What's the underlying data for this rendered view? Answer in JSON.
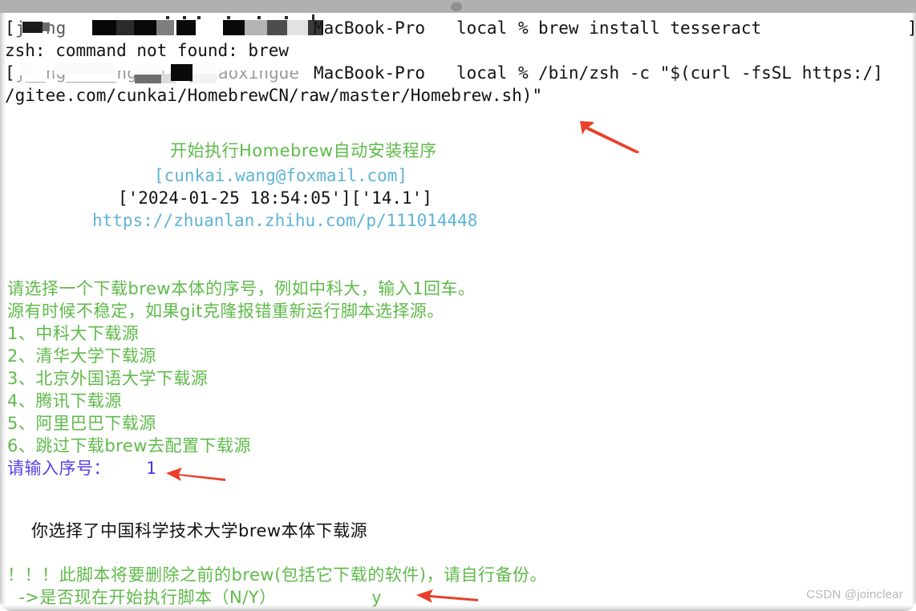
{
  "window": {
    "kind": "macos-terminal",
    "titlebar_color": "#b0b0b0",
    "background": "#ffffff"
  },
  "colors": {
    "foreground": "#121212",
    "green": "#5fba4a",
    "cyan": "#5eb3d6",
    "blue": "#4b35e0",
    "purple": "#5b3fe8",
    "arrow_red": "#e8402a",
    "watermark_gray": "#b7b7b7"
  },
  "terminal": {
    "prompt_1": {
      "bracket_open": "[",
      "redacted_user": "",
      "host": "MacBook-Pro",
      "cwd": "local",
      "sigil": "%",
      "command": "brew install tesseract",
      "bracket_close": "]"
    },
    "output_1": "zsh: command not found: brew",
    "prompt_2": {
      "bracket_open": "[",
      "ghost_user": "j__ng_____ng__jingxiaoxingde",
      "host": "MacBook-Pro",
      "cwd": "local",
      "sigil": "%",
      "command": "/bin/zsh -c \"$(curl -fsSL https:/]",
      "command_wrap": "/gitee.com/cunkai/HomebrewCN/raw/master/Homebrew.sh)\""
    },
    "banner": {
      "title": "开始执行Homebrew自动安装程序",
      "contact": "[cunkai.wang@foxmail.com]",
      "timestamp": "['2024-01-25 18:54:05']['14.1']",
      "link": "https://zhuanlan.zhihu.com/p/111014448"
    },
    "menu": {
      "instruction_1": "请选择一个下载brew本体的序号，例如中科大，输入1回车。",
      "instruction_2": "源有时候不稳定，如果git克隆报错重新运行脚本选择源。",
      "options": [
        "1、中科大下载源",
        "2、清华大学下载源",
        "3、北京外国语大学下载源",
        "4、腾讯下载源",
        "5、阿里巴巴下载源",
        "6、跳过下载brew去配置下载源"
      ],
      "input_prompt": "请输入序号：",
      "input_value": "1"
    },
    "selection_result": "你选择了中国科学技术大学brew本体下载源",
    "warning": "！！！此脚本将要删除之前的brew(包括它下载的软件)，请自行备份。",
    "confirm_prompt": "  ->是否现在开始执行脚本（N/Y）",
    "confirm_value": "y"
  },
  "annotations": {
    "arrow_1_label": "points-to-install-command",
    "arrow_2_label": "points-to-source-number-input",
    "arrow_3_label": "points-to-confirm-answer"
  },
  "watermark": {
    "text": "CSDN @joinclear"
  }
}
